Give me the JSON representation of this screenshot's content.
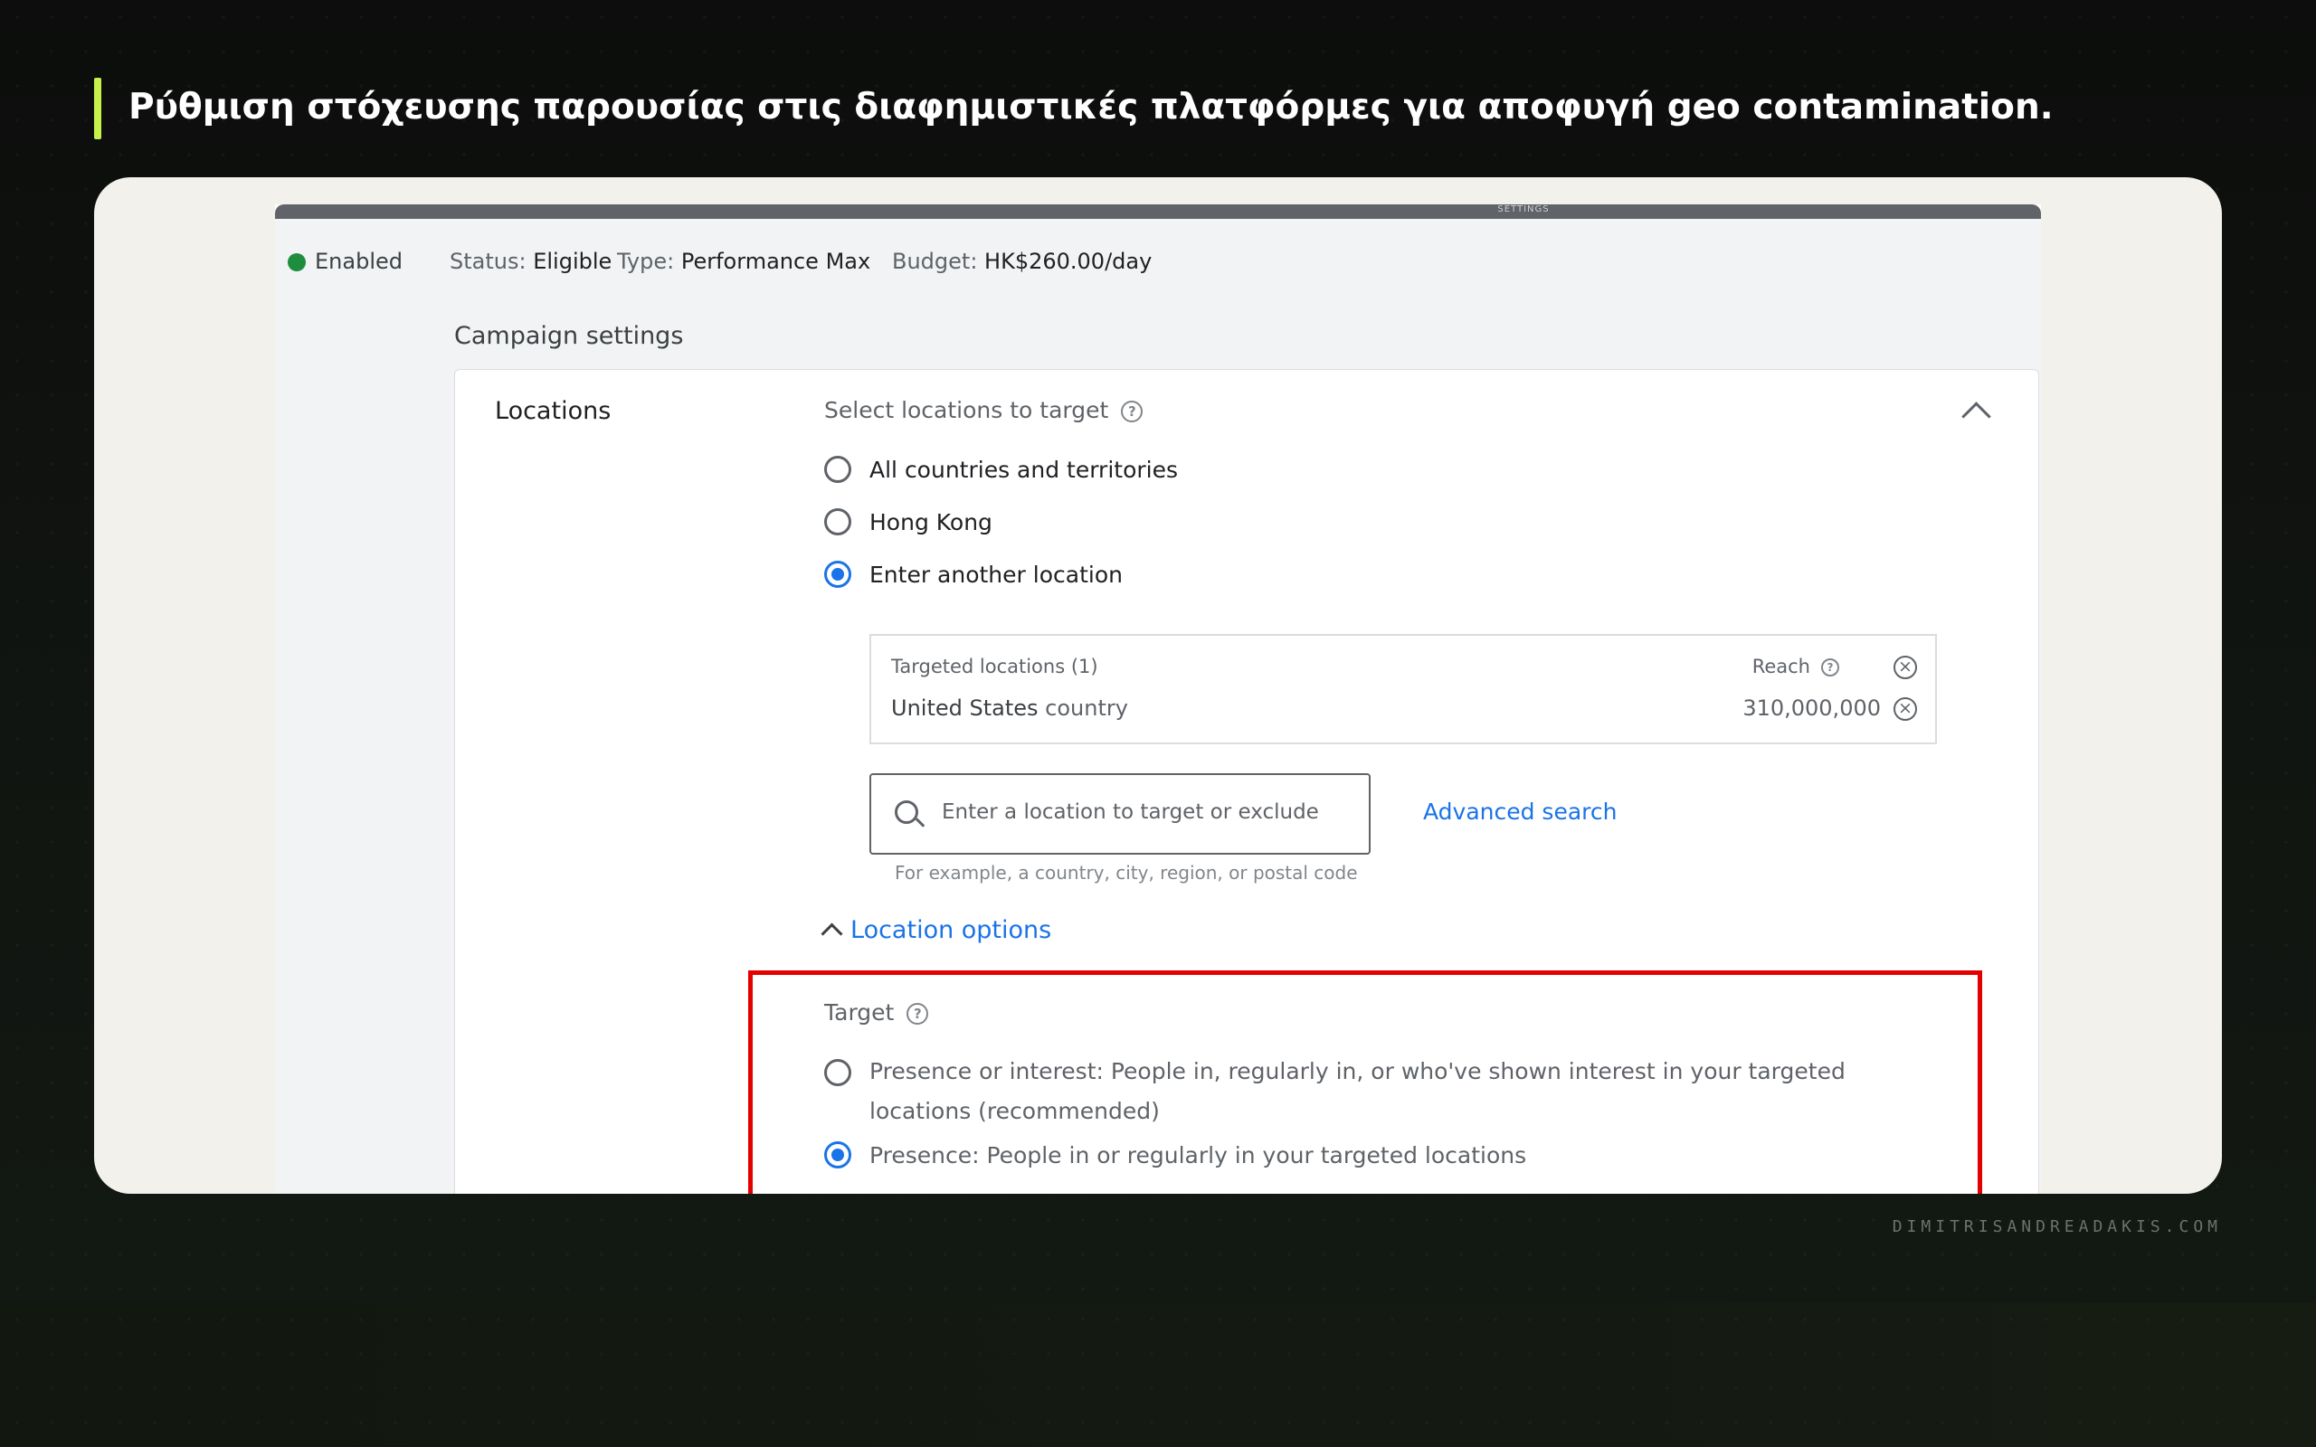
{
  "slide": {
    "heading": "Ρύθμιση στόχευσης παρουσίας στις διαφημιστικές πλατφόρμες για αποφυγή geo contamination.",
    "watermark": "DIMITRISANDREADAKIS.COM",
    "accent_color": "#c6f04a"
  },
  "screenshot": {
    "top_bar_label": "SETTINGS",
    "status_bar": {
      "enabled": "Enabled",
      "status_label": "Status:",
      "status_value": "Eligible",
      "type_label": "Type:",
      "type_value": "Performance Max",
      "budget_label": "Budget:",
      "budget_value": "HK$260.00/day"
    },
    "campaign_settings_title": "Campaign settings",
    "locations": {
      "section_label": "Locations",
      "select_label": "Select locations to target",
      "options": [
        {
          "label": "All countries and territories",
          "selected": false
        },
        {
          "label": "Hong Kong",
          "selected": false
        },
        {
          "label": "Enter another location",
          "selected": true
        }
      ],
      "targeted": {
        "header": "Targeted locations (1)",
        "reach_label": "Reach",
        "country_name": "United States",
        "country_type": "country",
        "reach_value": "310,000,000"
      },
      "search": {
        "placeholder": "Enter a location to target or exclude",
        "hint": "For example, a country, city, region, or postal code"
      },
      "advanced_search": "Advanced search",
      "location_options": "Location options",
      "target": {
        "label": "Target",
        "options": [
          {
            "label": "Presence or interest: People in, regularly in, or who've shown interest in your targeted locations (recommended)",
            "selected": false
          },
          {
            "label": "Presence: People in or regularly in your targeted locations",
            "selected": true
          }
        ]
      }
    },
    "colors": {
      "status_green": "#1e8e3e",
      "link_blue": "#1a73e8",
      "highlight_red": "#e50000"
    }
  }
}
